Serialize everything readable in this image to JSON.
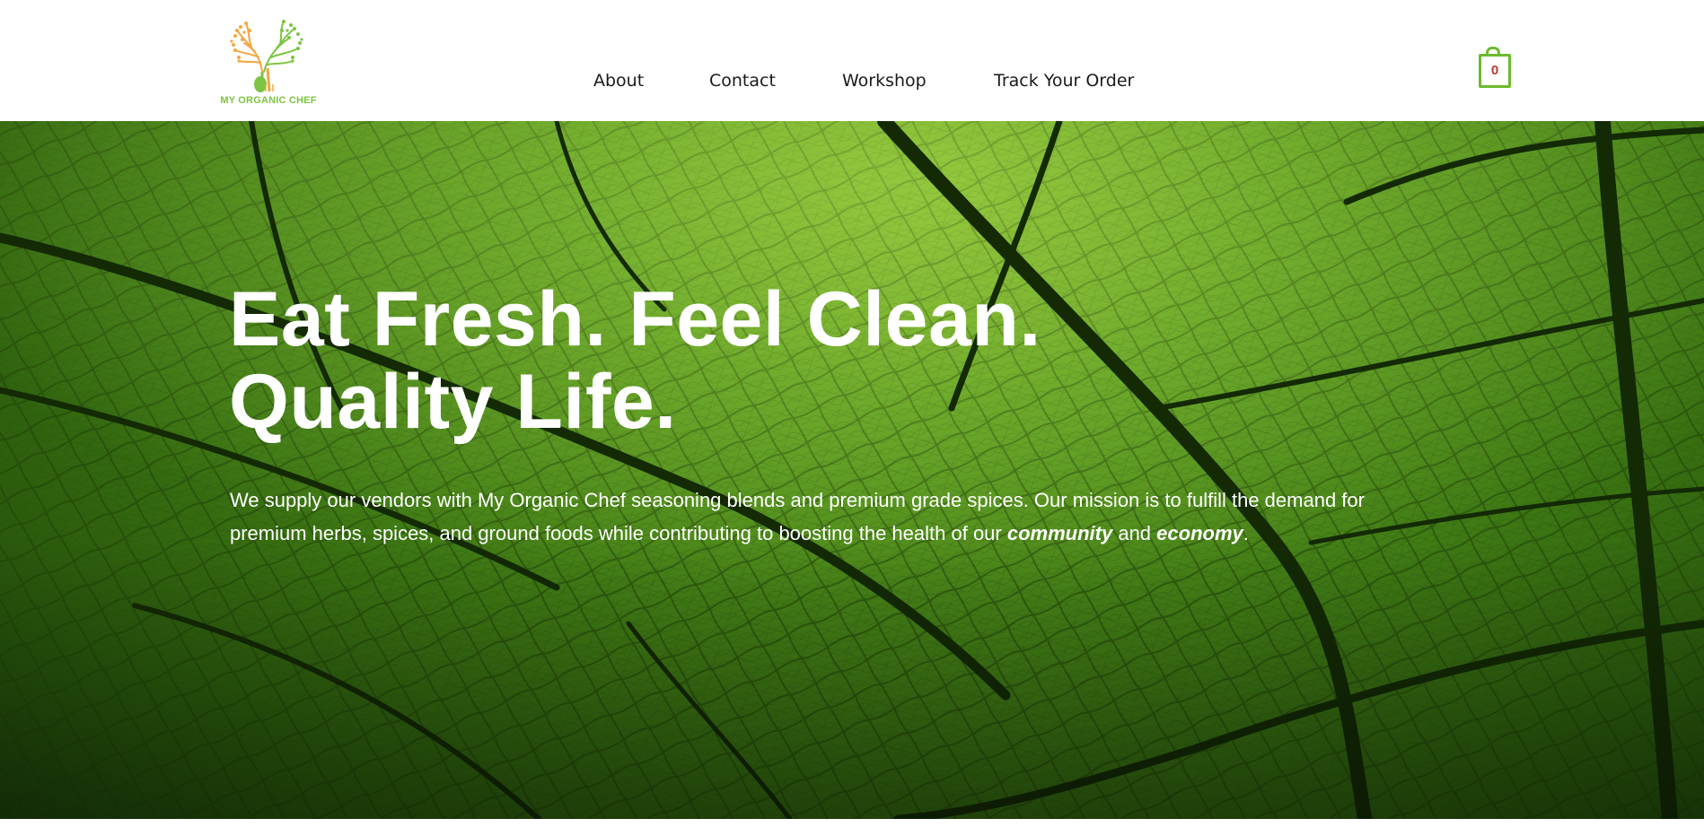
{
  "header": {
    "logo_text": "MY ORGANIC CHEF",
    "nav": [
      {
        "label": "About"
      },
      {
        "label": "Contact"
      },
      {
        "label": "Workshop"
      },
      {
        "label": "Track Your Order"
      }
    ],
    "cart_count": "0"
  },
  "hero": {
    "title_line1": "Eat Fresh. Feel Clean.",
    "title_line2": "Quality Life.",
    "text_main": "We supply our vendors with My Organic Chef seasoning blends and premium grade spices. Our mission is to fulfill the demand for premium herbs, spices, and ground foods while contributing to boosting the health of our ",
    "text_emph1": "community",
    "text_and": " and ",
    "text_emph2": "economy",
    "text_end": "."
  },
  "colors": {
    "brand_green": "#6cbb2d",
    "logo_orange": "#f4a640",
    "cart_count_red": "#c0392b",
    "leaf_green": "#4f8c1b"
  },
  "icons": {
    "logo": "tree-spoon-fork-logo",
    "cart": "shopping-bag-icon"
  }
}
